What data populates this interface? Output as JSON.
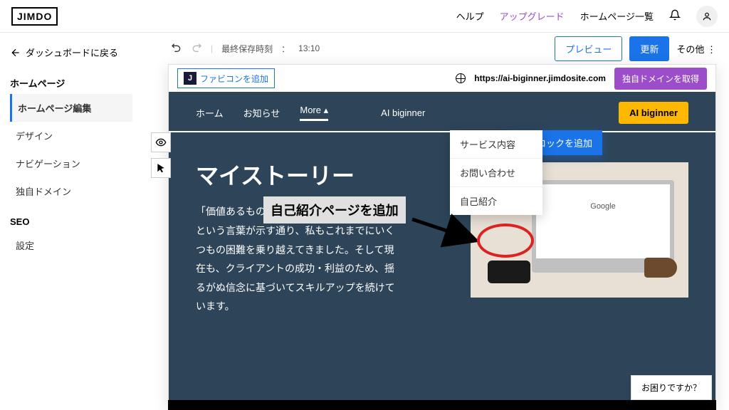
{
  "top": {
    "logo": "JIMDO",
    "help": "ヘルプ",
    "upgrade": "アップグレード",
    "homepage_list": "ホームページ一覧"
  },
  "sidebar": {
    "back": "ダッシュボードに戻る",
    "section1_title": "ホームページ",
    "items1": [
      "ホームページ編集",
      "デザイン",
      "ナビゲーション",
      "独自ドメイン"
    ],
    "section2_title": "SEO",
    "items2": [
      "設定"
    ]
  },
  "editor": {
    "last_saved_label": "最終保存時刻",
    "last_saved_time": "13:10",
    "preview": "プレビュー",
    "update": "更新",
    "other": "その他"
  },
  "canvas": {
    "add_favicon": "ファビコンを追加",
    "site_url": "https://ai-biginner.jimdosite.com",
    "own_domain": "独自ドメインを取得"
  },
  "site": {
    "nav": {
      "home": "ホーム",
      "news": "お知らせ",
      "more": "More",
      "ai": "AI biginner"
    },
    "cta": "AI biginner",
    "dropdown": [
      "サービス内容",
      "お問い合わせ",
      "自己紹介"
    ],
    "add_block": "ブロックを追加",
    "hero_title": "マイストーリー",
    "hero_para": "「価値あるものほど成し遂げることは難しい」という言葉が示す通り、私もこれまでにいくつもの困難を乗り越えてきました。そして現在も、クライアントの成功・利益のため、揺るがぬ信念に基づいてスキルアップを続けています。"
  },
  "annotation": "自己紹介ページを追加",
  "help_bubble": "お困りですか？"
}
